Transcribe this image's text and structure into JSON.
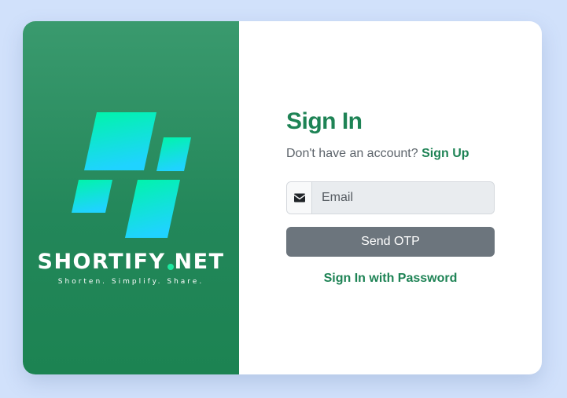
{
  "brand": {
    "name_part1": "SHORTIFY",
    "name_part2": "NET",
    "tagline": "Shorten. Simplify. Share.",
    "logo_icon": "shortify-logo-icon",
    "accent_color": "#1de9a0"
  },
  "form": {
    "title": "Sign In",
    "signup_prompt": "Don't have an account?",
    "signup_link": "Sign Up",
    "email_icon": "envelope-icon",
    "email_placeholder": "Email",
    "email_value": "",
    "send_otp_label": "Send OTP",
    "password_link": "Sign In with Password"
  },
  "colors": {
    "primary_green": "#1e8355",
    "button_gray": "#6c757d",
    "background": "#d1e1fb"
  }
}
